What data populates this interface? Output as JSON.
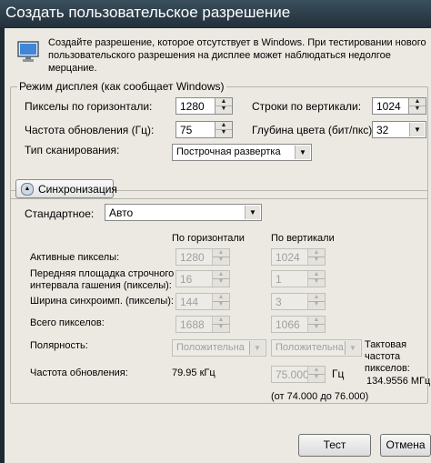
{
  "window": {
    "title": "Создать пользовательское разрешение"
  },
  "intro": {
    "text_line1": "Создайте разрешение, которое отсутствует в Windows. При тестировании нового",
    "text_line2": "пользовательского разрешения на дисплее может наблюдаться недолгое",
    "text_line3": "мерцание."
  },
  "display_mode": {
    "group_label": "Режим дисплея (как сообщает Windows)",
    "h_pixels_label": "Пикселы по горизонтали:",
    "h_pixels_value": "1280",
    "v_lines_label": "Строки по вертикали:",
    "v_lines_value": "1024",
    "refresh_label": "Частота обновления (Гц):",
    "refresh_value": "75",
    "color_depth_label": "Глубина цвета (бит/пкс):",
    "color_depth_value": "32",
    "scan_label": "Тип сканирования:",
    "scan_value": "Построчная развертка"
  },
  "sync": {
    "toggle_label": "Синхронизация",
    "standard_label": "Стандартное:",
    "standard_value": "Авто",
    "col_h": "По горизонтали",
    "col_v": "По вертикали",
    "active_label": "Активные пикселы:",
    "active_h": "1280",
    "active_v": "1024",
    "porch_label_1": "Передняя площадка строчного",
    "porch_label_2": "интервала гашения (пикселы):",
    "porch_h": "16",
    "porch_v": "1",
    "width_label": "Ширина синхроимп. (пикселы):",
    "width_h": "144",
    "width_v": "3",
    "total_label": "Всего пикселов:",
    "total_h": "1688",
    "total_v": "1066",
    "polarity_label": "Полярность:",
    "polarity_h": "Положительна",
    "polarity_v": "Положительна",
    "refresh_label": "Частота обновления:",
    "refresh_h": "79.95 кГц",
    "refresh_v": "75.000",
    "refresh_unit": "Гц",
    "range_text": "(от 74.000 до 76.000)",
    "pixel_clock_1": "Тактовая",
    "pixel_clock_2": "частота",
    "pixel_clock_3": "пикселов:",
    "pixel_clock_value": "134.9556 МГц"
  },
  "buttons": {
    "test": "Тест",
    "cancel": "Отмена"
  },
  "icons": {
    "monitor": "monitor-icon",
    "chevron": "chevron-up-icon"
  }
}
